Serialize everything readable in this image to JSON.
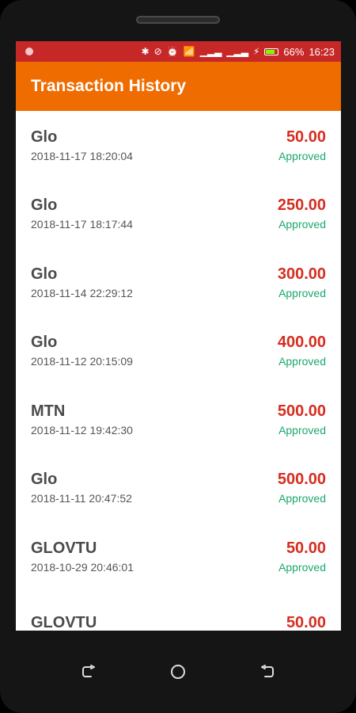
{
  "status_bar": {
    "battery": "66%",
    "time": "16:23",
    "icons": [
      "notification-dot-icon",
      "bluetooth-icon",
      "do-not-disturb-icon",
      "alarm-icon",
      "wifi-icon",
      "signal-icon",
      "signal-icon",
      "charging-icon",
      "battery-icon"
    ],
    "battery_fill": 0.66,
    "colors": {
      "status_bar_bg": "#c62828",
      "battery_fill": "#7CFC00"
    }
  },
  "app_bar": {
    "title": "Transaction History",
    "bg": "#ef6c00"
  },
  "transactions": [
    {
      "network": "Glo",
      "date": "2018-11-17 18:20:04",
      "amount": "50.00",
      "status": "Approved"
    },
    {
      "network": "Glo",
      "date": "2018-11-17 18:17:44",
      "amount": "250.00",
      "status": "Approved"
    },
    {
      "network": "Glo",
      "date": "2018-11-14 22:29:12",
      "amount": "300.00",
      "status": "Approved"
    },
    {
      "network": "Glo",
      "date": "2018-11-12 20:15:09",
      "amount": "400.00",
      "status": "Approved"
    },
    {
      "network": "MTN",
      "date": "2018-11-12 19:42:30",
      "amount": "500.00",
      "status": "Approved"
    },
    {
      "network": "Glo",
      "date": "2018-11-11 20:47:52",
      "amount": "500.00",
      "status": "Approved"
    },
    {
      "network": "GLOVTU",
      "date": "2018-10-29 20:46:01",
      "amount": "50.00",
      "status": "Approved"
    },
    {
      "network": "GLOVTU",
      "date": "",
      "amount": "50.00",
      "status": ""
    }
  ],
  "colors": {
    "amount": "#d62d20",
    "approved": "#1aa86b"
  },
  "nav_bar": {
    "icons": [
      "recent-apps-icon",
      "home-icon",
      "back-icon"
    ]
  }
}
